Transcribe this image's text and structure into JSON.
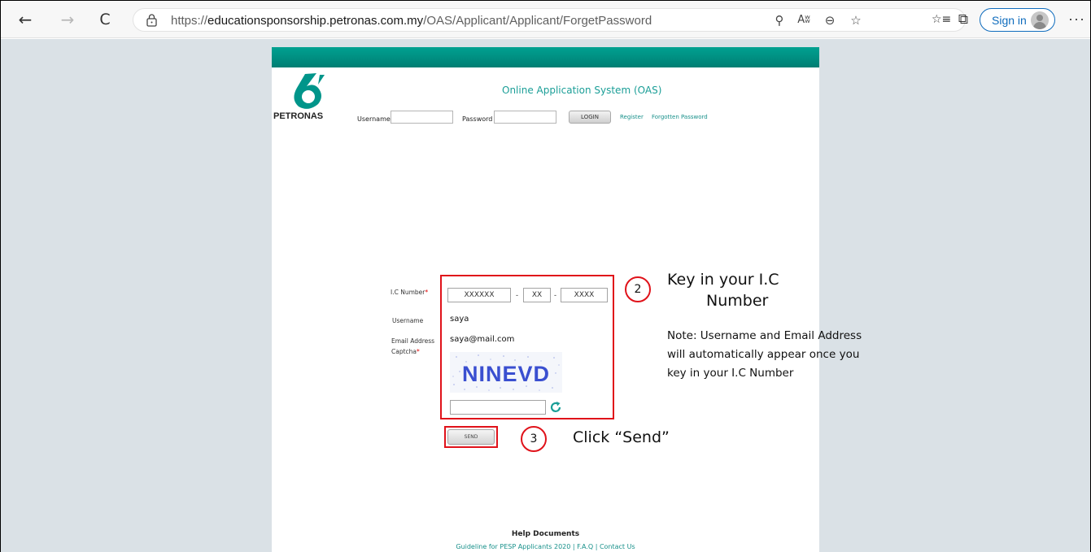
{
  "browser": {
    "url_prefix": "https://",
    "url_domain": "educationsponsorship.petronas.com.my",
    "url_path": "/OAS/Applicant/Applicant/ForgetPassword",
    "sign_in_label": "Sign in",
    "more_label": "···",
    "back_icon": "←",
    "forward_icon": "→",
    "refresh_icon": "C",
    "key_icon": "⚲",
    "read_aloud_icon": "Aʬ",
    "zoom_icon": "⊖",
    "favorite_add_icon": "☆",
    "favorites_icon": "☆≡",
    "collections_icon": "⧉"
  },
  "header": {
    "brand": "PETRONAS",
    "app_title": "Online Application System (OAS)",
    "username_label": "Username",
    "password_label": "Password",
    "login_label": "LOGIN",
    "register_link": "Register",
    "forgot_link": "Forgotten Password"
  },
  "form": {
    "ic_label": "I.C Number",
    "required_mark": "*",
    "ic_part1": "XXXXXX",
    "ic_part2": "XX",
    "ic_part3": "XXXX",
    "ic_sep": "-",
    "username_label": "Username",
    "username_value": "saya",
    "email_label": "Email Address",
    "email_value": "saya@mail.com",
    "captcha_label": "Captcha",
    "captcha_text": "NINEVD",
    "send_label": "SEND"
  },
  "annotations": {
    "step2_number": "2",
    "step2_line1": "Key in your I.C",
    "step2_line2": "Number",
    "note_line1": "Note: Username and Email Address",
    "note_line2": "will automatically appear once you",
    "note_line3": "key in your I.C Number",
    "step3_number": "3",
    "step3_text": "Click “Send”"
  },
  "footer": {
    "help_title": "Help Documents",
    "help_links": "Guideline for PESP Applicants 2020 | F.A.Q | Contact Us"
  }
}
